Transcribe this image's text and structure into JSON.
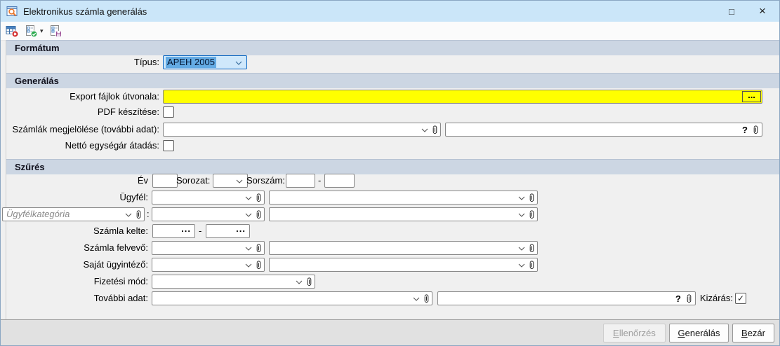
{
  "window": {
    "title": "Elektronikus számla generálás"
  },
  "icons": {
    "maximize": "□",
    "close": "×",
    "dropdown_arrow": "▾",
    "ellipsis": "...",
    "question": "?",
    "check": "✓",
    "dash": "-",
    "colon": ":"
  },
  "toolbar": {
    "buttons": [
      {
        "icon": "export-cancel-icon"
      },
      {
        "icon": "run-check-icon",
        "has_dropdown": true
      },
      {
        "icon": "save-settings-icon"
      }
    ]
  },
  "sections": {
    "format": {
      "title": "Formátum",
      "tipus_label": "Típus:",
      "tipus_value": "APEH 2005"
    },
    "generalas": {
      "title": "Generálás",
      "export_label": "Export fájlok útvonala:",
      "pdf_label": "PDF készítése:",
      "megjeloles_label": "Számlák megjelölése (további adat):",
      "netto_label": "Nettó egységár átadás:"
    },
    "szures": {
      "title": "Szűrés",
      "ev_label": "Év",
      "sorozat_label": "Sorozat:",
      "sorszam_label": "Sorszám:",
      "ugyfel_label": "Ügyfél:",
      "ugyfelkategoria_placeholder": "Ügyfélkategória",
      "szamla_kelte_label": "Számla kelte:",
      "szamla_felvevo_label": "Számla felvevő:",
      "sajat_ugyintezo_label": "Saját ügyintéző:",
      "fizetesi_mod_label": "Fizetési mód:",
      "tovabbi_adat_label": "További adat:",
      "kizaras_label": "Kizárás:"
    }
  },
  "footer": {
    "buttons": [
      {
        "accel": "E",
        "rest": "llenőrzés",
        "enabled": false
      },
      {
        "accel": "G",
        "rest": "enerálás",
        "enabled": true
      },
      {
        "accel": "B",
        "rest": "ezár",
        "enabled": true
      }
    ]
  }
}
